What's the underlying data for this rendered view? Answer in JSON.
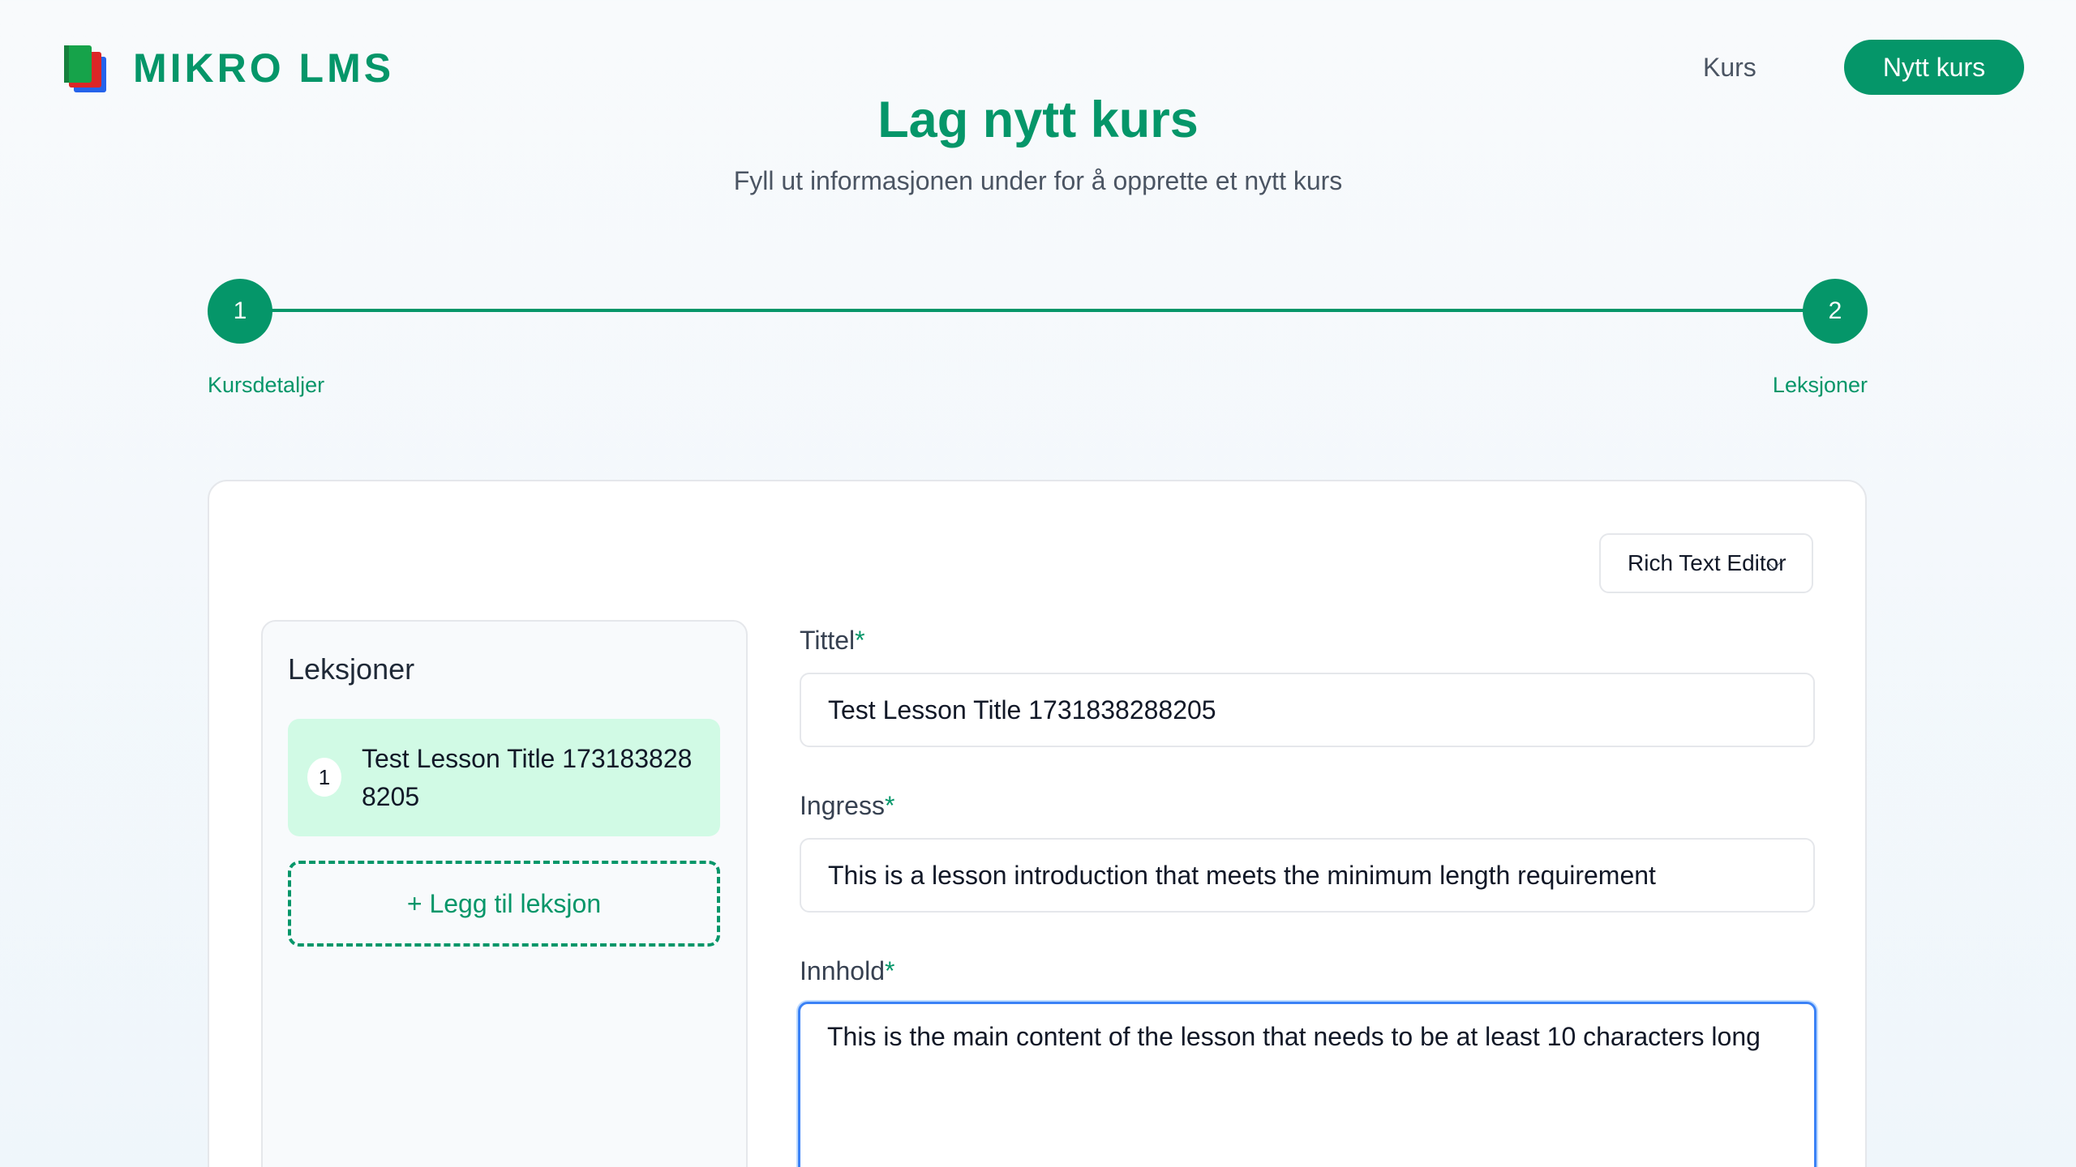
{
  "header": {
    "brand": "MIKRO LMS",
    "nav_link": "Kurs",
    "nav_button": "Nytt kurs"
  },
  "page": {
    "title": "Lag nytt kurs",
    "subtitle": "Fyll ut informasjonen under for å opprette et nytt kurs"
  },
  "stepper": {
    "steps": [
      {
        "number": "1",
        "label": "Kursdetaljer"
      },
      {
        "number": "2",
        "label": "Leksjoner"
      }
    ]
  },
  "editor_mode": {
    "selected": "Rich Text Editor"
  },
  "lessons": {
    "title": "Leksjoner",
    "items": [
      {
        "number": "1",
        "title": "Test Lesson Title 1731838288205"
      }
    ],
    "add_label": "+ Legg til leksjon"
  },
  "form": {
    "title_label": "Tittel",
    "title_value": "Test Lesson Title 1731838288205",
    "ingress_label": "Ingress",
    "ingress_value": "This is a lesson introduction that meets the minimum length requirement",
    "content_label": "Innhold",
    "content_value": "This is the main content of the lesson that needs to be at least 10 characters long",
    "required_mark": "*"
  },
  "colors": {
    "accent": "#059669",
    "selected_bg": "#d1fae5",
    "focus_border": "#3b82f6"
  }
}
